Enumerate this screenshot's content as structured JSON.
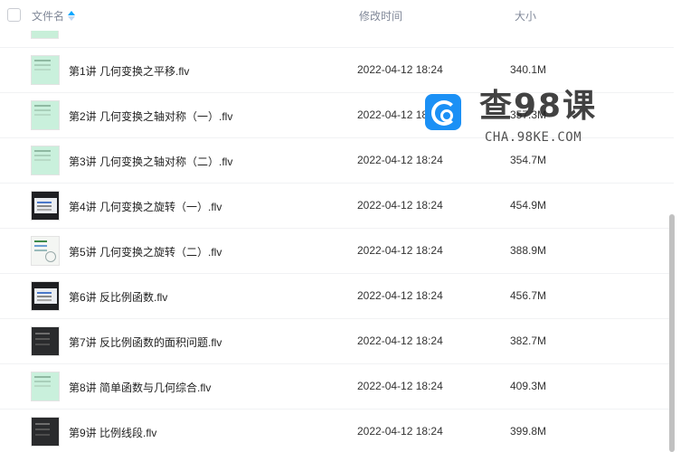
{
  "header": {
    "name_label": "文件名",
    "time_label": "修改时间",
    "size_label": "大小"
  },
  "files": [
    {
      "name": "第1讲 几何变换之平移.flv",
      "time": "2022-04-12 18:24",
      "size": "340.1M",
      "thumb": "mint"
    },
    {
      "name": "第2讲 几何变换之轴对称（一）.flv",
      "time": "2022-04-12 18:24",
      "size": "357.3M",
      "thumb": "mint"
    },
    {
      "name": "第3讲 几何变换之轴对称（二）.flv",
      "time": "2022-04-12 18:24",
      "size": "354.7M",
      "thumb": "mint"
    },
    {
      "name": "第4讲 几何变换之旋转（一）.flv",
      "time": "2022-04-12 18:24",
      "size": "454.9M",
      "thumb": "screen"
    },
    {
      "name": "第5讲 几何变换之旋转（二）.flv",
      "time": "2022-04-12 18:24",
      "size": "388.9M",
      "thumb": "white"
    },
    {
      "name": "第6讲 反比例函数.flv",
      "time": "2022-04-12 18:24",
      "size": "456.7M",
      "thumb": "screen"
    },
    {
      "name": "第7讲 反比例函数的面积问题.flv",
      "time": "2022-04-12 18:24",
      "size": "382.7M",
      "thumb": "dark"
    },
    {
      "name": "第8讲 简单函数与几何综合.flv",
      "time": "2022-04-12 18:24",
      "size": "409.3M",
      "thumb": "mint"
    },
    {
      "name": "第9讲 比例线段.flv",
      "time": "2022-04-12 18:24",
      "size": "399.8M",
      "thumb": "dark"
    }
  ],
  "watermark": {
    "title": "查98课",
    "subtitle": "CHA.98KE.COM",
    "icon": "search-logo-icon"
  },
  "colors": {
    "sort_active": "#06a7ff",
    "header_text": "#818999",
    "logo_blue": "#1b90f5"
  }
}
